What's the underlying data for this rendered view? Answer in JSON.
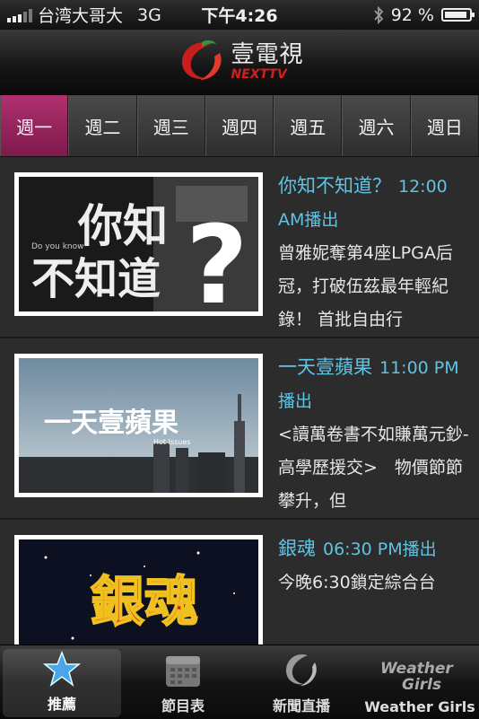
{
  "status": {
    "carrier": "台湾大哥大",
    "network": "3G",
    "time": "下午4:26",
    "battery": "92 %",
    "battery_level": 0.92
  },
  "header": {
    "logo_cn": "壹電視",
    "logo_en": "NEXTTV"
  },
  "tabs": [
    "週一",
    "週二",
    "週三",
    "週四",
    "週五",
    "週六",
    "週日"
  ],
  "items": [
    {
      "title": "你知不知道？",
      "time": "12:00 AM播出",
      "desc": "曾雅妮奪第4座LPGA后冠，打破伍茲最年輕紀錄！ 首批自由行",
      "thumb_text": "你知不知道",
      "thumb_sub": "Do you know"
    },
    {
      "title": "一天壹蘋果",
      "time": "11:00 PM播出",
      "desc": "<讀萬卷書不如賺萬元鈔-高學歷援交>　物價節節攀升，但",
      "thumb_text": "一天壹蘋果",
      "thumb_sub": "Hot Issues"
    },
    {
      "title": "銀魂",
      "time": "06:30 PM播出",
      "desc": "今晚6:30鎖定綜合台",
      "thumb_text": "銀魂",
      "thumb_sub": ""
    }
  ],
  "tabbar": [
    {
      "label": "推薦",
      "icon": "star-icon"
    },
    {
      "label": "節目表",
      "icon": "calendar-icon"
    },
    {
      "label": "新聞直播",
      "icon": "news-live-icon"
    },
    {
      "label": "Weather Girls",
      "icon": "weather-girls-icon",
      "icon_text_1": "Weather",
      "icon_text_2": "Girls"
    }
  ]
}
